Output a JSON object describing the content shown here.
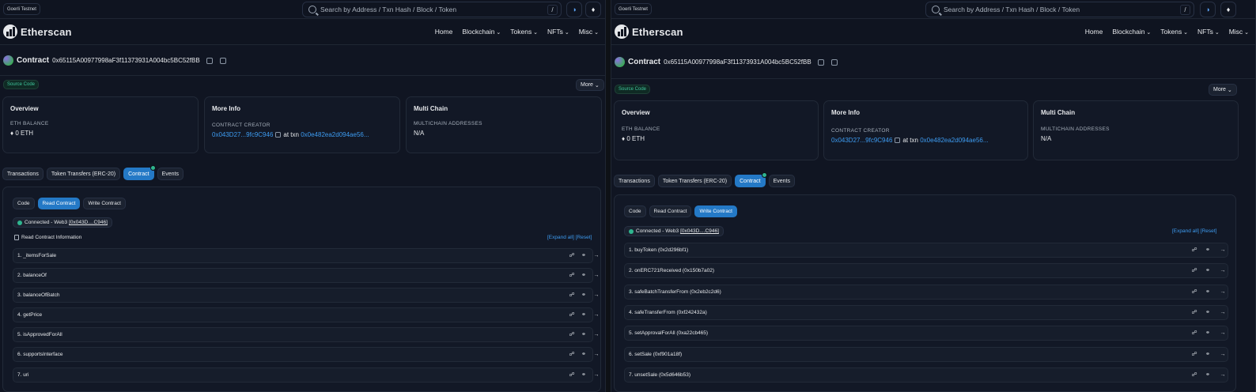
{
  "network_badge": "Goerli Testnet",
  "search": {
    "placeholder": "Search by Address / Txn Hash / Block / Token",
    "shortcut": "/"
  },
  "brand": "Etherscan",
  "nav": [
    "Home",
    "Blockchain",
    "Tokens",
    "NFTs",
    "Misc"
  ],
  "contract": {
    "title": "Contract",
    "address": "0x65115A00977998aF3f11373931A004bc5BC52fBB"
  },
  "source_badge": "Source Code",
  "more_button": "More",
  "overview": {
    "title": "Overview",
    "eth_balance_label": "ETH BALANCE",
    "eth_balance_value": "0 ETH"
  },
  "more_info": {
    "title": "More Info",
    "creator_label": "CONTRACT CREATOR",
    "creator": "0x043D27...9fc9C946",
    "at_txn": "at txn",
    "txn": "0x0e482ea2d094ae56..."
  },
  "multi_chain": {
    "title": "Multi Chain",
    "label": "MULTICHAIN ADDRESSES",
    "value": "N/A"
  },
  "tabs": [
    "Transactions",
    "Token Transfers (ERC-20)",
    "Contract",
    "Events"
  ],
  "subtabs": [
    "Code",
    "Read Contract",
    "Write Contract"
  ],
  "connection": {
    "prefix": "Connected - Web3",
    "address": "[0x043D....C946]"
  },
  "read_info": "Read Contract Information",
  "expand_all": "[Expand all]",
  "reset": "[Reset]",
  "read_functions": [
    "1. _itemsForSale",
    "2. balanceOf",
    "3. balanceOfBatch",
    "4. getPrice",
    "5. isApprovedForAll",
    "6. supportsInterface",
    "7. uri"
  ],
  "write_functions": [
    "1. buyToken (0x2d296bf1)",
    "2. onERC721Received (0x150b7a02)",
    "3. safeBatchTransferFrom (0x2eb2c2d6)",
    "4. safeTransferFrom (0xf242432a)",
    "5. setApprovalForAll (0xa22cb465)",
    "6. setSale (0xf901a18f)",
    "7. unsetSale (0x5d646b53)"
  ]
}
